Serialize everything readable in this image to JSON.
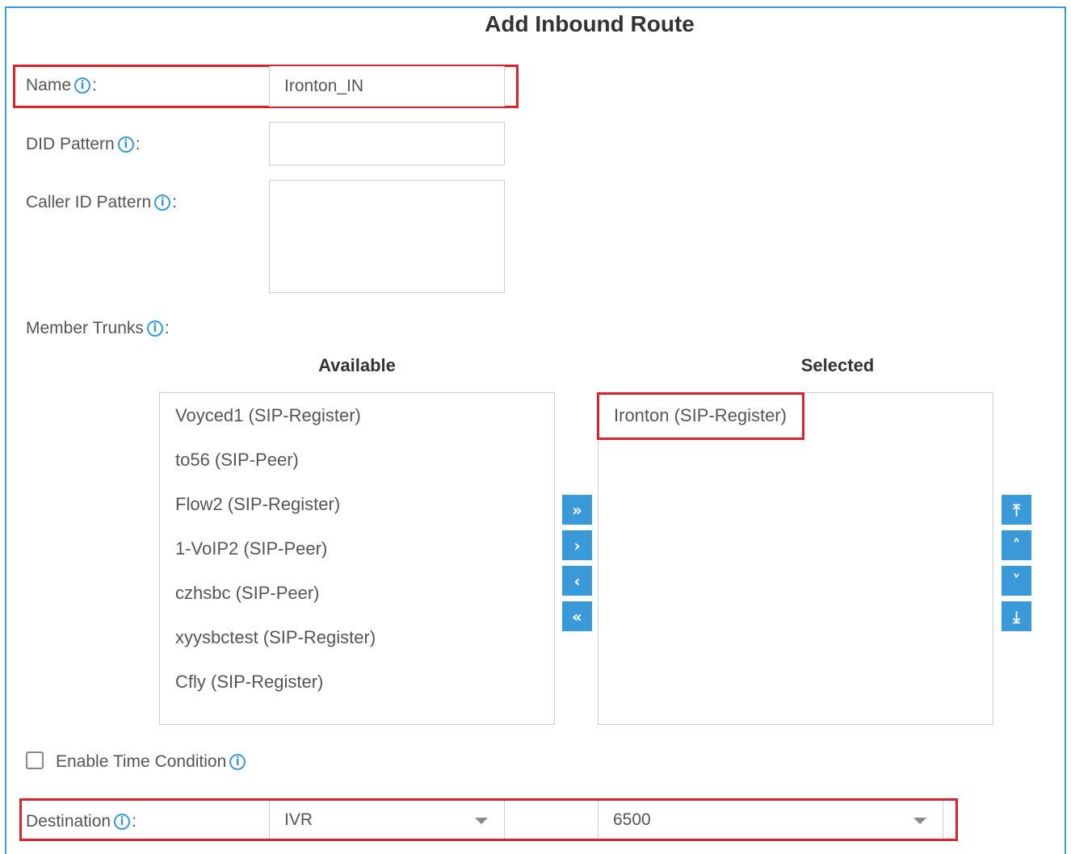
{
  "form": {
    "title": "Add Inbound Route",
    "name_label": "Name",
    "name_value": "Ironton_IN",
    "did_label": "DID Pattern",
    "did_value": "",
    "callerid_label": "Caller ID Pattern",
    "callerid_value": "",
    "trunks_label": "Member Trunks",
    "colon": ":",
    "info_glyph": "i"
  },
  "trunks": {
    "available_title": "Available",
    "selected_title": "Selected",
    "available": [
      "Voyced1 (SIP-Register)",
      "to56 (SIP-Peer)",
      "Flow2 (SIP-Register)",
      "1-VoIP2 (SIP-Peer)",
      "czhsbc (SIP-Peer)",
      "xyysbctest (SIP-Register)",
      "Cfly (SIP-Register)"
    ],
    "selected": [
      "Ironton (SIP-Register)"
    ],
    "move_buttons": {
      "add_all": "»",
      "add": "›",
      "remove": "‹",
      "remove_all": "«"
    },
    "order_buttons": {
      "top": "⤒",
      "up": "˄",
      "down": "˅",
      "bottom": "⤓"
    }
  },
  "time_condition": {
    "label": "Enable Time Condition",
    "checked": false
  },
  "destination": {
    "label": "Destination",
    "type_value": "IVR",
    "target_value": "6500"
  },
  "colors": {
    "accent": "#3a9ad9",
    "highlight": "#d9232d"
  },
  "icons": [
    "info-icon",
    "chevron-double-right-icon",
    "chevron-right-icon",
    "chevron-left-icon",
    "chevron-double-left-icon",
    "move-top-icon",
    "chevron-up-icon",
    "chevron-down-icon",
    "move-bottom-icon",
    "dropdown-caret-icon"
  ]
}
